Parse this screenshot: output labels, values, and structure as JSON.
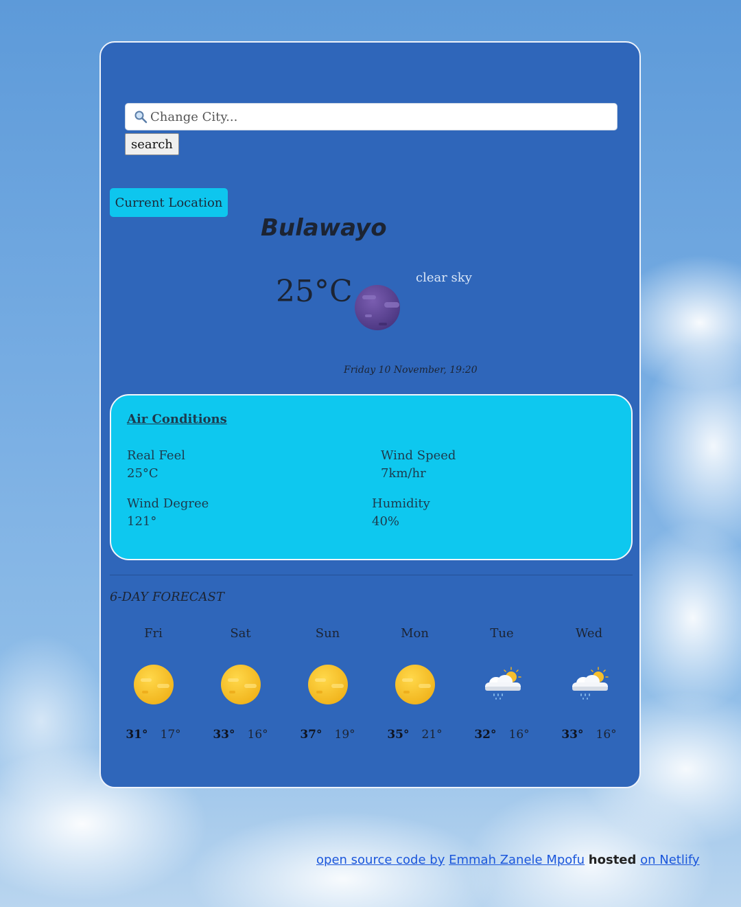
{
  "search": {
    "placeholder": "Change City...",
    "button_label": "search"
  },
  "current_location_label": "Current Location",
  "current": {
    "city": "Bulawayo",
    "temperature": "25°C",
    "description": "clear sky",
    "datetime": "Friday 10 November, 19:20",
    "icon": "moon-icon"
  },
  "air_conditions": {
    "title": "Air Conditions",
    "real_feel": {
      "label": "Real Feel",
      "value": "25°C"
    },
    "wind_speed": {
      "label": "Wind Speed",
      "value": "7km/hr"
    },
    "wind_degree": {
      "label": "Wind Degree",
      "value": "121°"
    },
    "humidity": {
      "label": "Humidity",
      "value": "40%"
    }
  },
  "forecast": {
    "title": "6-DAY FORECAST",
    "days": [
      {
        "name": "Fri",
        "icon": "sun-icon",
        "high": "31°",
        "low": "17°"
      },
      {
        "name": "Sat",
        "icon": "sun-icon",
        "high": "33°",
        "low": "16°"
      },
      {
        "name": "Sun",
        "icon": "sun-icon",
        "high": "37°",
        "low": "19°"
      },
      {
        "name": "Mon",
        "icon": "sun-icon",
        "high": "35°",
        "low": "21°"
      },
      {
        "name": "Tue",
        "icon": "rain-cloud-sun-icon",
        "high": "32°",
        "low": "16°"
      },
      {
        "name": "Wed",
        "icon": "rain-cloud-sun-icon",
        "high": "33°",
        "low": "16°"
      }
    ]
  },
  "footer": {
    "source_link": "open source code by",
    "author_link": "Emmah Zanele Mpofu",
    "hosted_text": "hosted",
    "host_link": "on Netlify"
  },
  "colors": {
    "card_bg": "#2f66ba",
    "accent_cyan": "#0ec8ef",
    "link": "#1a56db"
  }
}
